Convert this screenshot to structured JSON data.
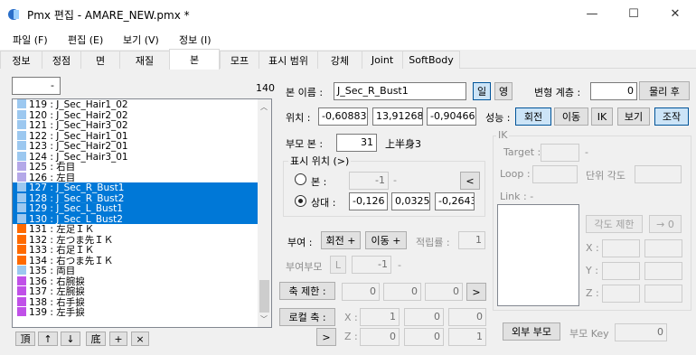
{
  "window": {
    "title": "Pmx 편집 - AMARE_NEW.pmx *",
    "min": "—",
    "max": "☐",
    "close": "✕"
  },
  "menu": [
    "파일 (F)",
    "편집 (E)",
    "보기 (V)",
    "정보 (I)"
  ],
  "tabs": [
    "정보",
    "정점",
    "면",
    "재질",
    "본",
    "모프",
    "표시 범위",
    "강체",
    "Joint",
    "SoftBody"
  ],
  "list": {
    "filter_value": "-",
    "count": "140",
    "rows": [
      {
        "text": "119 : J_Sec_Hair1_02",
        "color": "#9cc8f0",
        "sel": false
      },
      {
        "text": "120 : J_Sec_Hair2_02",
        "color": "#9cc8f0",
        "sel": false
      },
      {
        "text": "121 : J_Sec_Hair3_02",
        "color": "#9cc8f0",
        "sel": false
      },
      {
        "text": "122 : J_Sec_Hair1_01",
        "color": "#9cc8f0",
        "sel": false
      },
      {
        "text": "123 : J_Sec_Hair2_01",
        "color": "#9cc8f0",
        "sel": false
      },
      {
        "text": "124 : J_Sec_Hair3_01",
        "color": "#9cc8f0",
        "sel": false
      },
      {
        "text": "125 : 右目",
        "color": "#b4a8e8",
        "sel": false
      },
      {
        "text": "126 : 左目",
        "color": "#b4a8e8",
        "sel": false
      },
      {
        "text": "127 : J_Sec_R_Bust1",
        "color": "#9cc8f0",
        "sel": true
      },
      {
        "text": "128 : J_Sec_R_Bust2",
        "color": "#9cc8f0",
        "sel": true
      },
      {
        "text": "129 : J_Sec_L_Bust1",
        "color": "#9cc8f0",
        "sel": true
      },
      {
        "text": "130 : J_Sec_L_Bust2",
        "color": "#9cc8f0",
        "sel": true
      },
      {
        "text": "131 : 左足ＩＫ",
        "color": "#ff6a00",
        "sel": false
      },
      {
        "text": "132 : 左つま先ＩＫ",
        "color": "#ff6a00",
        "sel": false
      },
      {
        "text": "133 : 右足ＩＫ",
        "color": "#ff6a00",
        "sel": false
      },
      {
        "text": "134 : 右つま先ＩＫ",
        "color": "#ff6a00",
        "sel": false
      },
      {
        "text": "135 : 両目",
        "color": "#9cc8f0",
        "sel": false
      },
      {
        "text": "136 : 右腕捩",
        "color": "#c050e8",
        "sel": false
      },
      {
        "text": "137 : 左腕捩",
        "color": "#c050e8",
        "sel": false
      },
      {
        "text": "138 : 右手捩",
        "color": "#c050e8",
        "sel": false
      },
      {
        "text": "139 : 左手捩",
        "color": "#c050e8",
        "sel": false
      }
    ],
    "buttons": [
      "頂",
      "↑",
      "↓",
      "底",
      "+",
      "×"
    ]
  },
  "bone": {
    "name_label": "본 이름 :",
    "name_value": "J_Sec_R_Bust1",
    "lang_jp": "일",
    "lang_en": "영",
    "deform_label": "변형 계층 :",
    "deform_value": "0",
    "physics_after": "물리 후",
    "pos_label": "위치 :",
    "pos_x": "-0,60883",
    "pos_y": "13,91268",
    "pos_z": "-0,90466",
    "perf_label": "성능 :",
    "perf_rotate": "회전",
    "perf_move": "이동",
    "perf_ik": "IK",
    "perf_visible": "보기",
    "perf_control": "조작",
    "parent_label": "부모 본 :",
    "parent_value": "31",
    "parent_name": "上半身3",
    "display_title": "표시 위치 (>)",
    "radio_bone": "본 :",
    "radio_bone_value": "-1",
    "radio_bone_dash": "-",
    "radio_rel": "상대 :",
    "rel_x": "-0,126",
    "rel_y": "0,0325",
    "rel_z": "-0,2643",
    "add_label": "부여 :",
    "add_rotate": "회전 +",
    "add_move": "이동 +",
    "add_rate_label": "적립률 :",
    "add_rate_value": "1",
    "add_parent_label": "부여부모",
    "add_parent_btn": "L",
    "add_parent_value": "-1",
    "add_parent_dash": "-",
    "axis_label": "축 제한 :",
    "axis_x": "0",
    "axis_y": "0",
    "axis_z": "0",
    "local_label": "로컬 축 :",
    "local_x_label": "X :",
    "local_z_label": "Z :",
    "local_x": [
      "1",
      "0",
      "0"
    ],
    "local_z": [
      "0",
      "0",
      "1"
    ],
    "arrow": ">",
    "arrow_left": "<",
    "outer_btn": "외부 부모",
    "parent_key_label": "부모 Key",
    "parent_key_value": "0"
  },
  "ik": {
    "title": "IK",
    "target_label": "Target :",
    "target_dash": "-",
    "loop_label": "Loop :",
    "unit_label": "단위 각도",
    "link_label": "Link : -",
    "angle_limit": "각도 제한",
    "to_zero": "→ 0",
    "x": "X :",
    "y": "Y :",
    "z": "Z :"
  }
}
